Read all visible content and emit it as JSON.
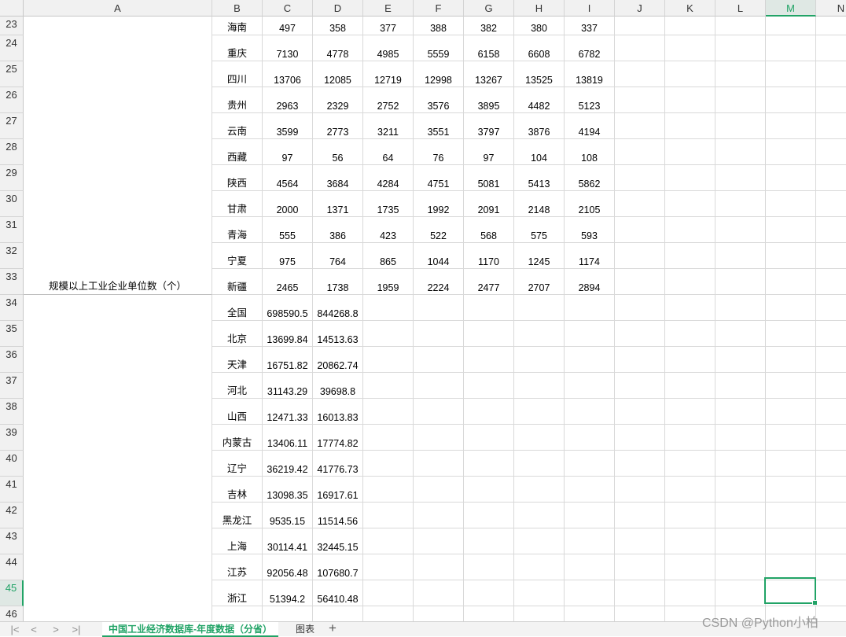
{
  "column_headers": [
    "A",
    "B",
    "C",
    "D",
    "E",
    "F",
    "G",
    "H",
    "I",
    "J",
    "K",
    "L",
    "M",
    "N"
  ],
  "selected_column": "M",
  "row_numbers": [
    "23",
    "24",
    "25",
    "26",
    "27",
    "28",
    "29",
    "30",
    "31",
    "32",
    "33",
    "34",
    "35",
    "36",
    "37",
    "38",
    "39",
    "40",
    "41",
    "42",
    "43",
    "44",
    "45",
    "46"
  ],
  "selected_row": "45",
  "merged_label": "规模以上工业企业单位数（个）",
  "rows": [
    [
      "海南",
      "497",
      "358",
      "377",
      "388",
      "382",
      "380",
      "337"
    ],
    [
      "重庆",
      "7130",
      "4778",
      "4985",
      "5559",
      "6158",
      "6608",
      "6782"
    ],
    [
      "四川",
      "13706",
      "12085",
      "12719",
      "12998",
      "13267",
      "13525",
      "13819"
    ],
    [
      "贵州",
      "2963",
      "2329",
      "2752",
      "3576",
      "3895",
      "4482",
      "5123"
    ],
    [
      "云南",
      "3599",
      "2773",
      "3211",
      "3551",
      "3797",
      "3876",
      "4194"
    ],
    [
      "西藏",
      "97",
      "56",
      "64",
      "76",
      "97",
      "104",
      "108"
    ],
    [
      "陕西",
      "4564",
      "3684",
      "4284",
      "4751",
      "5081",
      "5413",
      "5862"
    ],
    [
      "甘肃",
      "2000",
      "1371",
      "1735",
      "1992",
      "2091",
      "2148",
      "2105"
    ],
    [
      "青海",
      "555",
      "386",
      "423",
      "522",
      "568",
      "575",
      "593"
    ],
    [
      "宁夏",
      "975",
      "764",
      "865",
      "1044",
      "1170",
      "1245",
      "1174"
    ],
    [
      "新疆",
      "2465",
      "1738",
      "1959",
      "2224",
      "2477",
      "2707",
      "2894"
    ],
    [
      "全国",
      "698590.5",
      "844268.8"
    ],
    [
      "北京",
      "13699.84",
      "14513.63"
    ],
    [
      "天津",
      "16751.82",
      "20862.74"
    ],
    [
      "河北",
      "31143.29",
      "39698.8"
    ],
    [
      "山西",
      "12471.33",
      "16013.83"
    ],
    [
      "内蒙古",
      "13406.11",
      "17774.82"
    ],
    [
      "辽宁",
      "36219.42",
      "41776.73"
    ],
    [
      "吉林",
      "13098.35",
      "16917.61"
    ],
    [
      "黑龙江",
      "9535.15",
      "11514.56"
    ],
    [
      "上海",
      "30114.41",
      "32445.15"
    ],
    [
      "江苏",
      "92056.48",
      "107680.7"
    ],
    [
      "浙江",
      "51394.2",
      "56410.48"
    ],
    [
      "",
      "",
      ""
    ]
  ],
  "sheet_tabs": {
    "nav_first": "|<",
    "nav_prev": "<",
    "nav_next": ">",
    "nav_last": ">|",
    "active": "中国工业经济数据库-年度数据（分省）",
    "other": "图表",
    "add": "+"
  },
  "watermark": "CSDN @Python小柏",
  "colors": {
    "accent": "#21a366",
    "grid": "#d9d9d9",
    "header_bg": "#f1f1f1"
  }
}
